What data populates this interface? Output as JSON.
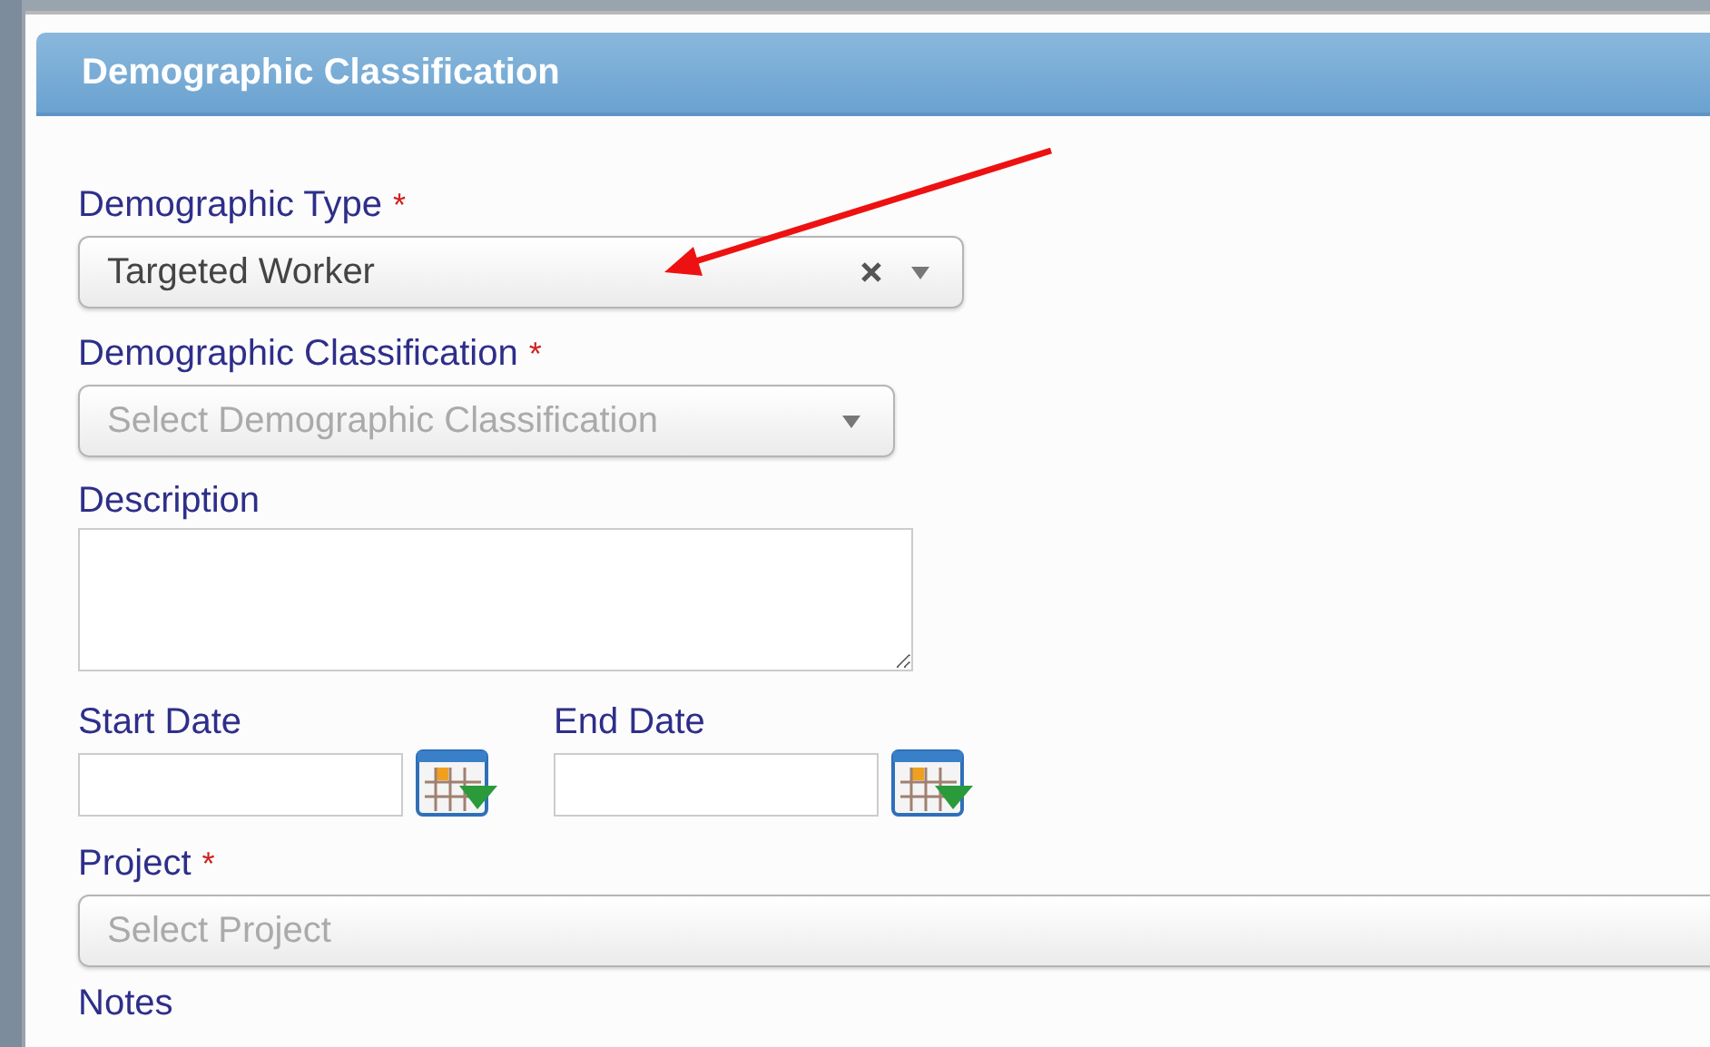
{
  "dialog": {
    "title": "Demographic Classification"
  },
  "fields": [
    {
      "kind": "select",
      "label": "Demographic Type",
      "required_mark": "*",
      "value": "Targeted Worker",
      "clearable": true
    },
    {
      "kind": "select",
      "label": "Demographic Classification",
      "required_mark": "*",
      "placeholder": "Select Demographic Classification",
      "clearable": false
    },
    {
      "kind": "textarea",
      "label": "Description"
    },
    {
      "kind": "dates",
      "items": [
        {
          "label": "Start Date"
        },
        {
          "label": "End Date"
        }
      ]
    },
    {
      "kind": "select",
      "label": "Project",
      "required_mark": "*",
      "placeholder": "Select Project",
      "clearable": false
    },
    {
      "kind": "label",
      "label": "Notes"
    }
  ]
}
